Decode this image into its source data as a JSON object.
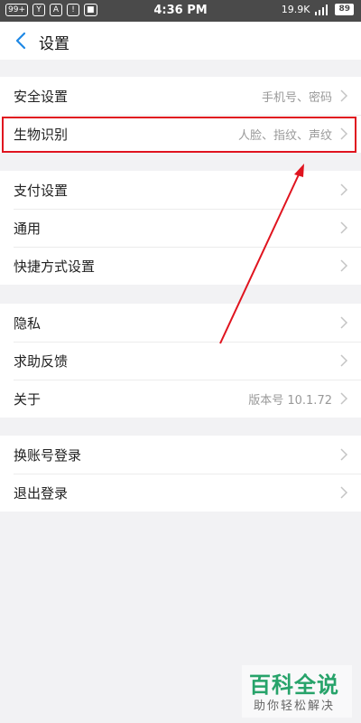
{
  "status_bar": {
    "left_badges": [
      "99+",
      "Y",
      "A",
      "!",
      "■"
    ],
    "time": "4:36 PM",
    "speed": "19.9K",
    "battery": "89"
  },
  "header": {
    "title": "设置"
  },
  "groups": [
    [
      {
        "label": "安全设置",
        "value": "手机号、密码"
      },
      {
        "label": "生物识别",
        "value": "人脸、指纹、声纹"
      }
    ],
    [
      {
        "label": "支付设置",
        "value": ""
      },
      {
        "label": "通用",
        "value": ""
      },
      {
        "label": "快捷方式设置",
        "value": ""
      }
    ],
    [
      {
        "label": "隐私",
        "value": ""
      },
      {
        "label": "求助反馈",
        "value": ""
      },
      {
        "label": "关于",
        "value": "版本号 10.1.72"
      }
    ],
    [
      {
        "label": "换账号登录",
        "value": ""
      },
      {
        "label": "退出登录",
        "value": ""
      }
    ]
  ],
  "watermark": {
    "title": "百科全说",
    "subtitle": "助你轻松解决"
  },
  "colors": {
    "highlight": "#e0141f",
    "back_icon": "#1e88e5",
    "watermark": "#27a36a"
  }
}
